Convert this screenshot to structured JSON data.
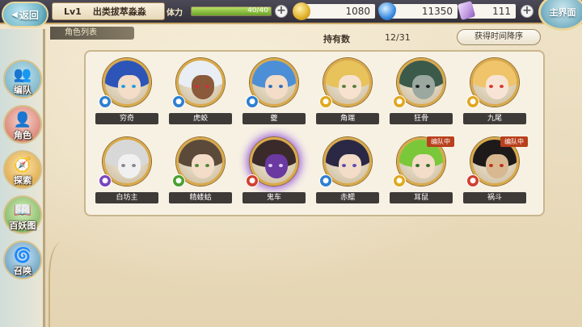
{
  "header": {
    "back_label": "返回",
    "home_label": "主界面",
    "level": "Lv1",
    "player_name": "出类拔萃淼淼",
    "stamina_label": "体力",
    "stamina_value": "40/40",
    "stamina_fraction": 1.0,
    "coins": "1080",
    "jade": "11350",
    "tickets": "111"
  },
  "sidebar": {
    "items": [
      {
        "label": "编队",
        "icon": "party-icon"
      },
      {
        "label": "角色",
        "icon": "character-icon"
      },
      {
        "label": "探索",
        "icon": "explore-icon"
      },
      {
        "label": "百妖图",
        "icon": "book-icon"
      },
      {
        "label": "召唤",
        "icon": "summon-icon"
      }
    ]
  },
  "main": {
    "section_title": "角色列表",
    "owned_label": "持有数",
    "owned_count": "12/31",
    "sort_label": "获得时间降序",
    "party_badge": "编队中",
    "characters": [
      {
        "name": "穷奇",
        "hair": "#2d55b8",
        "skin": "#f3dcc8",
        "eye": "#1e9fe0",
        "element": "#2e7fd0",
        "in_party": false
      },
      {
        "name": "虎蛟",
        "hair": "#e8eef3",
        "skin": "#8a5a3a",
        "eye": "#d03040",
        "element": "#2e7fd0",
        "in_party": false
      },
      {
        "name": "夔",
        "hair": "#4d8fd6",
        "skin": "#f3dcc8",
        "eye": "#2f6fb8",
        "element": "#2e7fd0",
        "in_party": false
      },
      {
        "name": "角端",
        "hair": "#e8c25a",
        "skin": "#f6e2cf",
        "eye": "#5a7f3a",
        "element": "#e0a820",
        "in_party": false
      },
      {
        "name": "狂骨",
        "hair": "#3c5a4a",
        "skin": "#9aa8a0",
        "eye": "#222222",
        "element": "#e0a820",
        "in_party": false
      },
      {
        "name": "九尾",
        "hair": "#f0c46a",
        "skin": "#f8e4d4",
        "eye": "#d83a30",
        "element": "#e0a820",
        "in_party": false
      },
      {
        "name": "白坊主",
        "hair": "#d8d8d8",
        "skin": "#f0f0f0",
        "eye": "#888888",
        "element": "#7a44c0",
        "in_party": false
      },
      {
        "name": "精蝼蛄",
        "hair": "#5b4a3a",
        "skin": "#f3dcc8",
        "eye": "#4f8a3a",
        "element": "#4aa030",
        "in_party": false
      },
      {
        "name": "鬼车",
        "hair": "#3a2a2a",
        "skin": "#6a3aa0",
        "eye": "#e0d0ff",
        "element": "#d04030",
        "in_party": false
      },
      {
        "name": "赤鱬",
        "hair": "#2a2845",
        "skin": "#f3dcc8",
        "eye": "#5a4ab0",
        "element": "#2e7fd0",
        "in_party": false
      },
      {
        "name": "耳鼠",
        "hair": "#7ac83a",
        "skin": "#f3dcc8",
        "eye": "#2f6f2a",
        "element": "#e0a820",
        "in_party": true
      },
      {
        "name": "祸斗",
        "hair": "#1e1a1a",
        "skin": "#d8b890",
        "eye": "#c03020",
        "element": "#d04030",
        "in_party": true
      }
    ]
  }
}
